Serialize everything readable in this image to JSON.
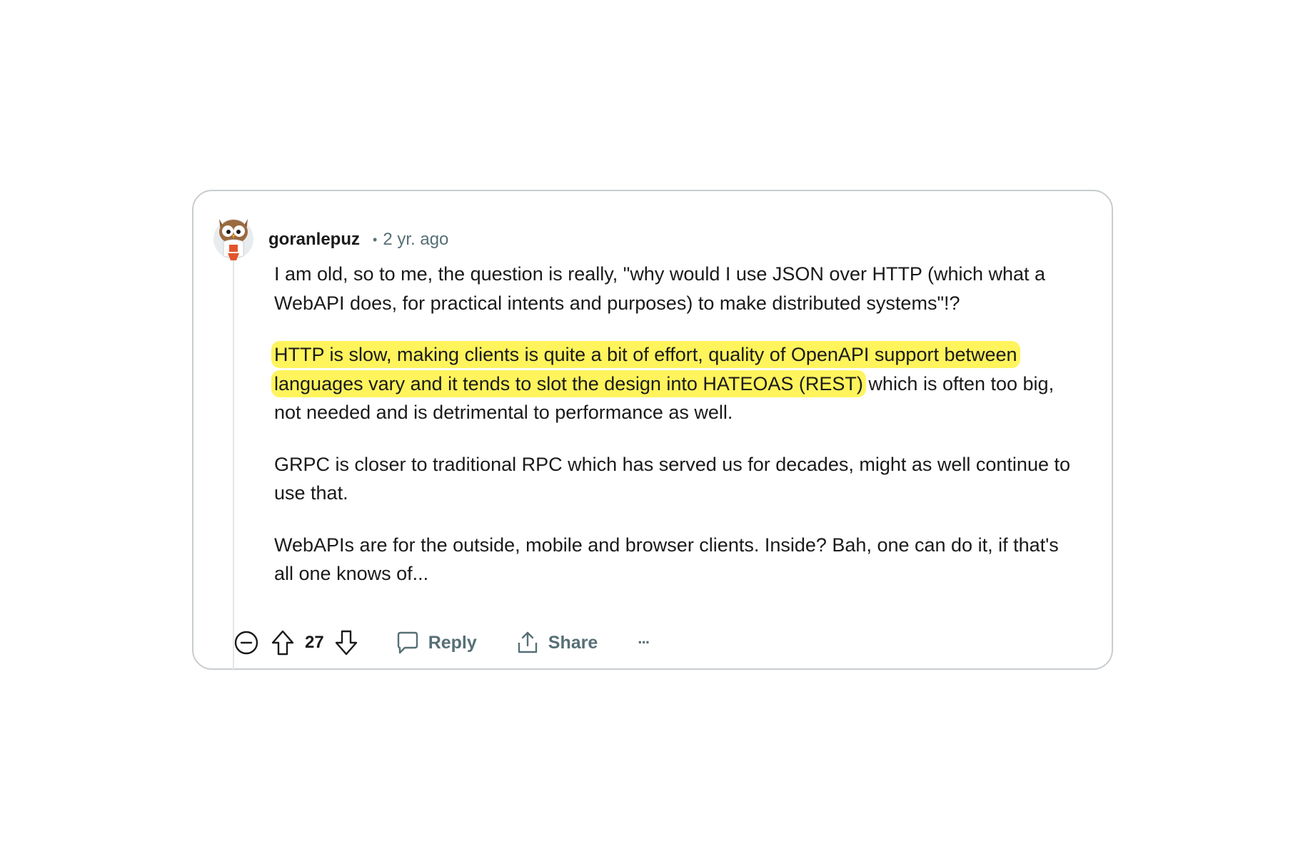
{
  "comment": {
    "author": "goranlepuz",
    "separator": "•",
    "time": "2 yr. ago",
    "paragraphs": [
      "I am old, so to me, the question is really, \"why would I use JSON over HTTP (which what a WebAPI does, for practical intents and purposes) to make distributed systems\"!?",
      "GRPC is closer to traditional RPC which has served us for decades, might as well continue to use that.",
      "WebAPIs are for the outside, mobile and browser clients. Inside? Bah, one can do it, if that's all one knows of..."
    ],
    "highlighted_paragraph": {
      "highlighted": "HTTP is slow, making clients is quite a bit of effort, quality of OpenAPI support between languages vary and it tends to slot the design into HATEOAS (REST)",
      "rest": " which is often too big, not needed and is detrimental to performance as well."
    },
    "highlight_color": "#fff45c"
  },
  "actions": {
    "collapse_icon": "minus-circle-icon",
    "upvote_icon": "arrow-up-icon",
    "score": "27",
    "downvote_icon": "arrow-down-icon",
    "reply_label": "Reply",
    "reply_icon": "speech-bubble-icon",
    "share_label": "Share",
    "share_icon": "share-icon",
    "more_label": "···"
  },
  "colors": {
    "text": "#1a1a1b",
    "meta": "#576f76",
    "border": "#c8cdd0"
  }
}
